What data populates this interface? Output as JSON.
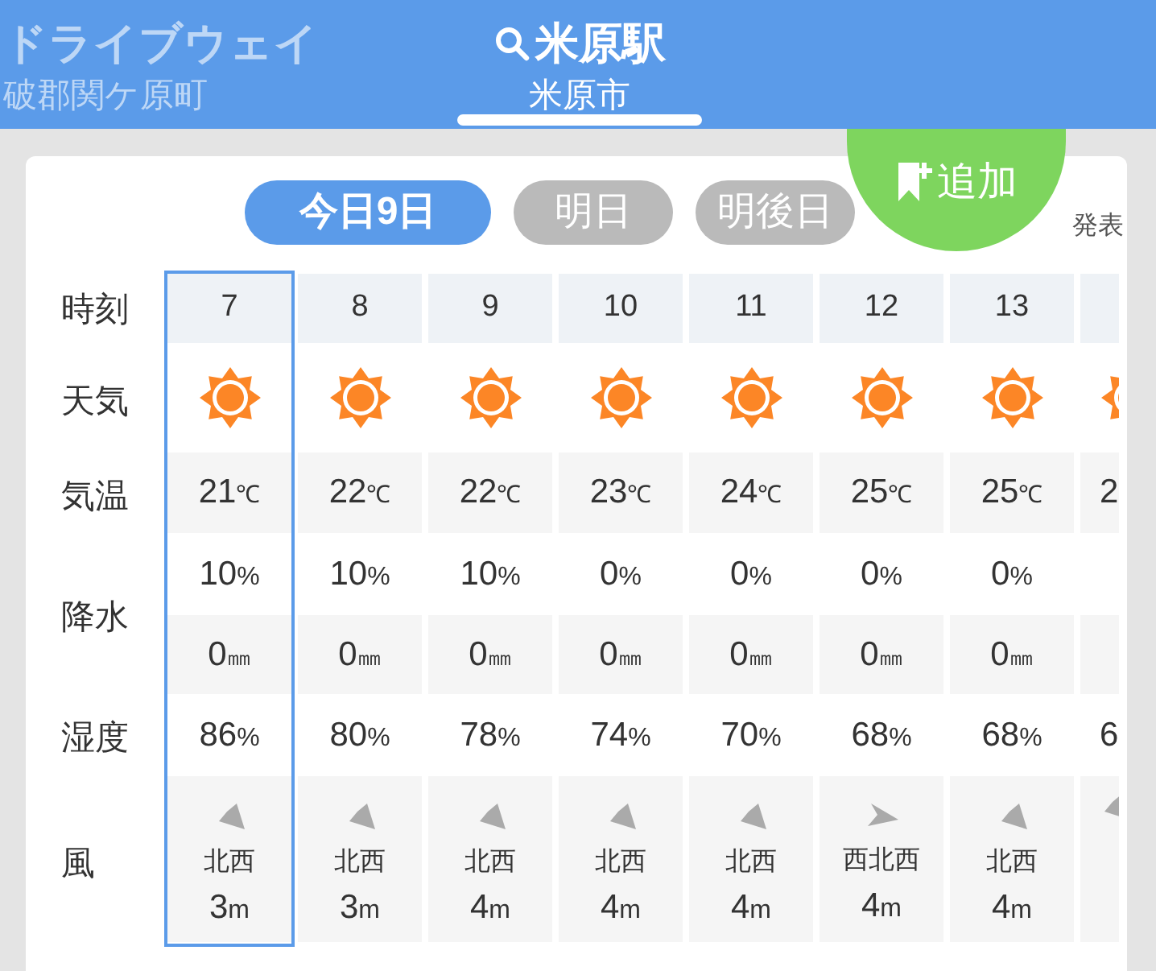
{
  "header": {
    "tabs": [
      {
        "title": "ドライブウェイ",
        "subtitle": "破郡関ケ原町",
        "selected": false,
        "search": false
      },
      {
        "title": "米原駅",
        "subtitle": "米原市",
        "selected": true,
        "search": true
      }
    ]
  },
  "add_button": {
    "label": "追加"
  },
  "announcement": "発表",
  "day_tabs": [
    {
      "label": "今日9日",
      "selected": true
    },
    {
      "label": "明日",
      "selected": false
    },
    {
      "label": "明後日",
      "selected": false
    }
  ],
  "table": {
    "labels": {
      "time": "時刻",
      "weather": "天気",
      "temperature": "気温",
      "precipitation": "降水",
      "humidity": "湿度",
      "wind": "風"
    },
    "columns": [
      {
        "hour": "7",
        "selected": true,
        "weather": {
          "kind": "sunny"
        },
        "temp": "21",
        "temp_unit": "℃",
        "chance": "10",
        "chance_unit": "%",
        "amount": "0",
        "amount_unit": "㎜",
        "humidity": "86",
        "humidity_unit": "%",
        "wind_arrow": {
          "kind": "southeast"
        },
        "direction": "北西",
        "speed": "3",
        "speed_unit": "m"
      },
      {
        "hour": "8",
        "selected": false,
        "weather": {
          "kind": "sunny"
        },
        "temp": "22",
        "temp_unit": "℃",
        "chance": "10",
        "chance_unit": "%",
        "amount": "0",
        "amount_unit": "㎜",
        "humidity": "80",
        "humidity_unit": "%",
        "wind_arrow": {
          "kind": "southeast"
        },
        "direction": "北西",
        "speed": "3",
        "speed_unit": "m"
      },
      {
        "hour": "9",
        "selected": false,
        "weather": {
          "kind": "sunny"
        },
        "temp": "22",
        "temp_unit": "℃",
        "chance": "10",
        "chance_unit": "%",
        "amount": "0",
        "amount_unit": "㎜",
        "humidity": "78",
        "humidity_unit": "%",
        "wind_arrow": {
          "kind": "southeast"
        },
        "direction": "北西",
        "speed": "4",
        "speed_unit": "m"
      },
      {
        "hour": "10",
        "selected": false,
        "weather": {
          "kind": "sunny"
        },
        "temp": "23",
        "temp_unit": "℃",
        "chance": "0",
        "chance_unit": "%",
        "amount": "0",
        "amount_unit": "㎜",
        "humidity": "74",
        "humidity_unit": "%",
        "wind_arrow": {
          "kind": "southeast"
        },
        "direction": "北西",
        "speed": "4",
        "speed_unit": "m"
      },
      {
        "hour": "11",
        "selected": false,
        "weather": {
          "kind": "sunny"
        },
        "temp": "24",
        "temp_unit": "℃",
        "chance": "0",
        "chance_unit": "%",
        "amount": "0",
        "amount_unit": "㎜",
        "humidity": "70",
        "humidity_unit": "%",
        "wind_arrow": {
          "kind": "southeast"
        },
        "direction": "北西",
        "speed": "4",
        "speed_unit": "m"
      },
      {
        "hour": "12",
        "selected": false,
        "weather": {
          "kind": "sunny"
        },
        "temp": "25",
        "temp_unit": "℃",
        "chance": "0",
        "chance_unit": "%",
        "amount": "0",
        "amount_unit": "㎜",
        "humidity": "68",
        "humidity_unit": "%",
        "wind_arrow": {
          "kind": "east-southeast"
        },
        "direction": "西北西",
        "speed": "4",
        "speed_unit": "m"
      },
      {
        "hour": "13",
        "selected": false,
        "weather": {
          "kind": "sunny"
        },
        "temp": "25",
        "temp_unit": "℃",
        "chance": "0",
        "chance_unit": "%",
        "amount": "0",
        "amount_unit": "㎜",
        "humidity": "68",
        "humidity_unit": "%",
        "wind_arrow": {
          "kind": "southeast"
        },
        "direction": "北西",
        "speed": "4",
        "speed_unit": "m"
      },
      {
        "partial": true,
        "selected": false,
        "weather": {
          "kind": "sunny"
        },
        "temp": "2",
        "humidity": "6",
        "wind_arrow": {
          "kind": "southeast"
        }
      }
    ]
  }
}
